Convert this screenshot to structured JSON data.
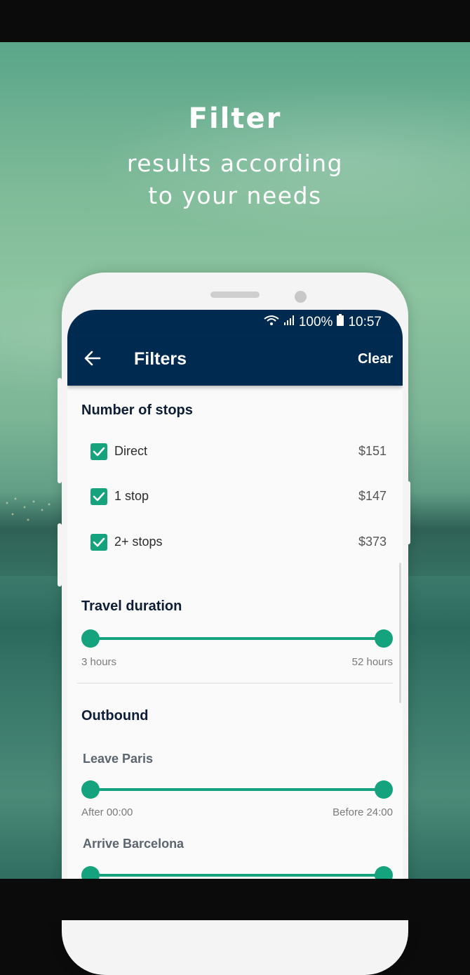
{
  "promo": {
    "title": "Filter",
    "subtitle_line1": "results according",
    "subtitle_line2": "to your needs"
  },
  "statusbar": {
    "battery": "100%",
    "time": "10:57"
  },
  "appbar": {
    "title": "Filters",
    "clear_label": "Clear",
    "back_icon": "arrow-left-icon"
  },
  "stops": {
    "title": "Number of stops",
    "options": [
      {
        "label": "Direct",
        "price": "$151",
        "checked": true
      },
      {
        "label": "1 stop",
        "price": "$147",
        "checked": true
      },
      {
        "label": "2+ stops",
        "price": "$373",
        "checked": true
      }
    ]
  },
  "duration": {
    "title": "Travel duration",
    "min_label": "3 hours",
    "max_label": "52 hours"
  },
  "outbound": {
    "title": "Outbound",
    "leave": {
      "label": "Leave Paris",
      "min_label": "After 00:00",
      "max_label": "Before 24:00"
    },
    "arrive": {
      "label": "Arrive Barcelona"
    }
  },
  "colors": {
    "accent": "#14a37d",
    "appbar": "#002a4f"
  }
}
